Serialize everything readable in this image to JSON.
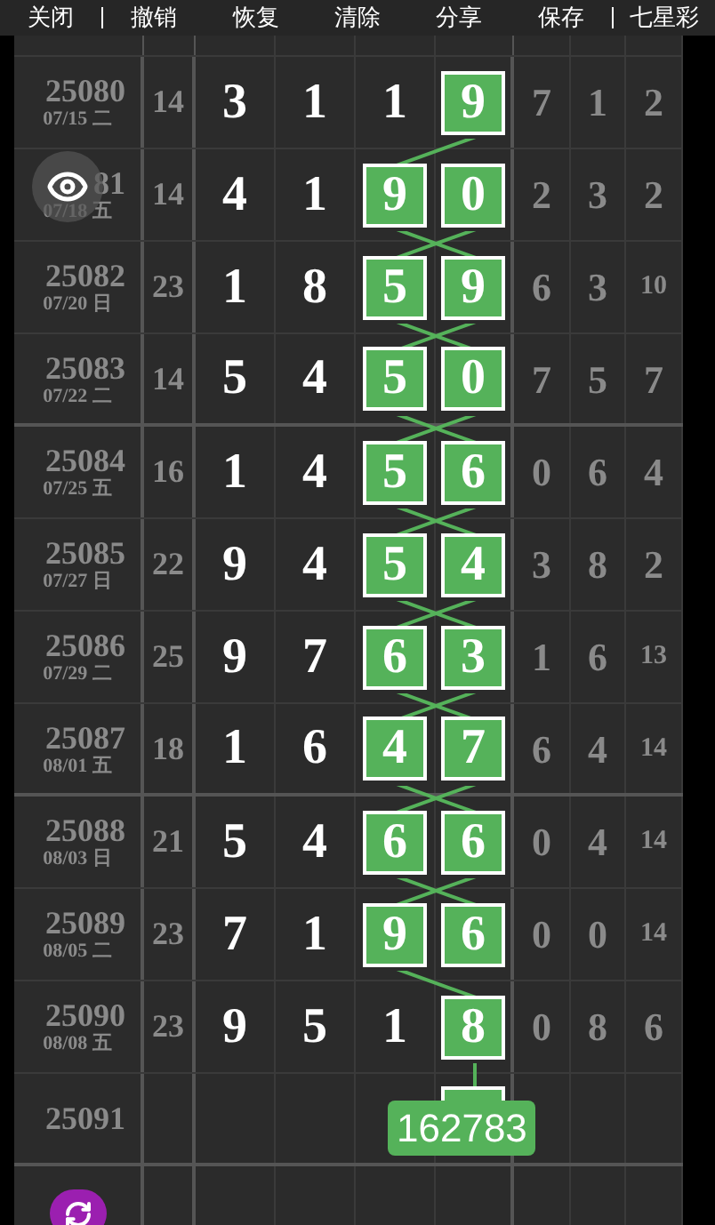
{
  "toolbar": [
    "关闭",
    "撤销",
    "恢复",
    "清除",
    "分享",
    "保存",
    "七星彩"
  ],
  "rows": [
    {
      "issue": "25080",
      "date": "07/15 二",
      "sum": "14",
      "digits": [
        {
          "value": "3",
          "highlighted": false
        },
        {
          "value": "1",
          "highlighted": false
        },
        {
          "value": "1",
          "highlighted": false
        },
        {
          "value": "9",
          "highlighted": true
        }
      ],
      "tail": [
        "7",
        "1",
        "2"
      ]
    },
    {
      "issue": "81",
      "date": "07/18 五",
      "sum": "14",
      "digits": [
        {
          "value": "4",
          "highlighted": false
        },
        {
          "value": "1",
          "highlighted": false
        },
        {
          "value": "9",
          "highlighted": true
        },
        {
          "value": "0",
          "highlighted": true
        }
      ],
      "tail": [
        "2",
        "3",
        "2"
      ]
    },
    {
      "issue": "25082",
      "date": "07/20 日",
      "sum": "23",
      "digits": [
        {
          "value": "1",
          "highlighted": false
        },
        {
          "value": "8",
          "highlighted": false
        },
        {
          "value": "5",
          "highlighted": true
        },
        {
          "value": "9",
          "highlighted": true
        }
      ],
      "tail": [
        "6",
        "3",
        "10"
      ]
    },
    {
      "issue": "25083",
      "date": "07/22 二",
      "sum": "14",
      "digits": [
        {
          "value": "5",
          "highlighted": false
        },
        {
          "value": "4",
          "highlighted": false
        },
        {
          "value": "5",
          "highlighted": true
        },
        {
          "value": "0",
          "highlighted": true
        }
      ],
      "tail": [
        "7",
        "5",
        "7"
      ]
    },
    {
      "issue": "25084",
      "date": "07/25 五",
      "sum": "16",
      "digits": [
        {
          "value": "1",
          "highlighted": false
        },
        {
          "value": "4",
          "highlighted": false
        },
        {
          "value": "5",
          "highlighted": true
        },
        {
          "value": "6",
          "highlighted": true
        }
      ],
      "tail": [
        "0",
        "6",
        "4"
      ]
    },
    {
      "issue": "25085",
      "date": "07/27 日",
      "sum": "22",
      "digits": [
        {
          "value": "9",
          "highlighted": false
        },
        {
          "value": "4",
          "highlighted": false
        },
        {
          "value": "5",
          "highlighted": true
        },
        {
          "value": "4",
          "highlighted": true
        }
      ],
      "tail": [
        "3",
        "8",
        "2"
      ]
    },
    {
      "issue": "25086",
      "date": "07/29 二",
      "sum": "25",
      "digits": [
        {
          "value": "9",
          "highlighted": false
        },
        {
          "value": "7",
          "highlighted": false
        },
        {
          "value": "6",
          "highlighted": true
        },
        {
          "value": "3",
          "highlighted": true
        }
      ],
      "tail": [
        "1",
        "6",
        "13"
      ]
    },
    {
      "issue": "25087",
      "date": "08/01 五",
      "sum": "18",
      "digits": [
        {
          "value": "1",
          "highlighted": false
        },
        {
          "value": "6",
          "highlighted": false
        },
        {
          "value": "4",
          "highlighted": true
        },
        {
          "value": "7",
          "highlighted": true
        }
      ],
      "tail": [
        "6",
        "4",
        "14"
      ]
    },
    {
      "issue": "25088",
      "date": "08/03 日",
      "sum": "21",
      "digits": [
        {
          "value": "5",
          "highlighted": false
        },
        {
          "value": "4",
          "highlighted": false
        },
        {
          "value": "6",
          "highlighted": true
        },
        {
          "value": "6",
          "highlighted": true
        }
      ],
      "tail": [
        "0",
        "4",
        "14"
      ]
    },
    {
      "issue": "25089",
      "date": "08/05 二",
      "sum": "23",
      "digits": [
        {
          "value": "7",
          "highlighted": false
        },
        {
          "value": "1",
          "highlighted": false
        },
        {
          "value": "9",
          "highlighted": true
        },
        {
          "value": "6",
          "highlighted": true
        }
      ],
      "tail": [
        "0",
        "0",
        "14"
      ]
    },
    {
      "issue": "25090",
      "date": "08/08 五",
      "sum": "23",
      "digits": [
        {
          "value": "9",
          "highlighted": false
        },
        {
          "value": "5",
          "highlighted": false
        },
        {
          "value": "1",
          "highlighted": false
        },
        {
          "value": "8",
          "highlighted": true
        }
      ],
      "tail": [
        "0",
        "8",
        "6"
      ]
    },
    {
      "issue": "25091",
      "digits": [
        {
          "highlighted": false
        },
        {
          "highlighted": false
        },
        {
          "highlighted": false
        },
        {
          "highlighted": true
        }
      ]
    }
  ],
  "prediction": "162783"
}
